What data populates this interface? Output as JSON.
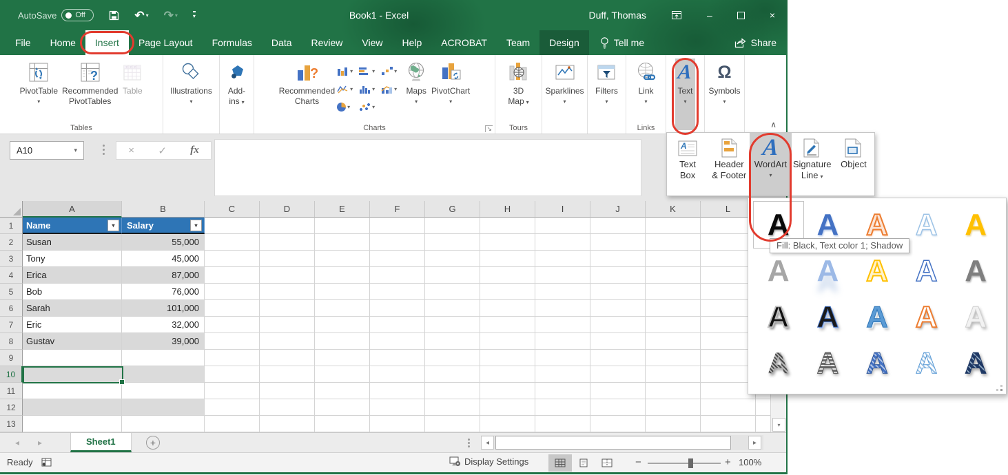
{
  "colors": {
    "title_green": "#217346",
    "design_tab_green": "#1A5C39",
    "table_header_blue": "#2E75B6",
    "band_gray": "#D9D9D9",
    "selection_green": "#217346",
    "annotation_red": "#E23B2E",
    "icon_blue": "#4472C4",
    "icon_gold": "#E8A33D"
  },
  "icons": {
    "dd": "▾",
    "undo": "↶",
    "redo": "↷",
    "minimize": "–",
    "close": "×",
    "collapse": "∧",
    "left": "◂",
    "right": "▸",
    "up": "▴",
    "down": "▾",
    "plus": "+",
    "minus": "−",
    "check": "✓",
    "cancel": "×",
    "omega": "Ω",
    "text_a": "A",
    "launcher": "↘"
  },
  "titlebar": {
    "autosave_label": "AutoSave",
    "autosave_state": "Off",
    "title": "Book1 - Excel",
    "user": "Duff, Thomas"
  },
  "tabs": {
    "items": [
      "File",
      "Home",
      "Insert",
      "Page Layout",
      "Formulas",
      "Data",
      "Review",
      "View",
      "Help",
      "ACROBAT",
      "Team",
      "Design"
    ],
    "active": "Insert",
    "tell_me": "Tell me",
    "share": "Share"
  },
  "ribbon": {
    "groups": {
      "tables": "Tables",
      "charts": "Charts",
      "tours": "Tours",
      "links": "Links"
    },
    "pivottable": "PivotTable",
    "recommended_pivottables_1": "Recommended",
    "recommended_pivottables_2": "PivotTables",
    "table": "Table",
    "illustrations": "Illustrations",
    "addins_1": "Add-",
    "addins_2": "ins",
    "recommended_charts_1": "Recommended",
    "recommended_charts_2": "Charts",
    "maps": "Maps",
    "pivotchart": "PivotChart",
    "map3d_1": "3D",
    "map3d_2": "Map",
    "sparklines": "Sparklines",
    "filters": "Filters",
    "link": "Link",
    "text": "Text",
    "symbols": "Symbols"
  },
  "formula_bar": {
    "name_box": "A10",
    "fx_label": "fx"
  },
  "text_menu": {
    "text_box_1": "Text",
    "text_box_2": "Box",
    "header_footer_1": "Header",
    "header_footer_2": "& Footer",
    "wordart": "WordArt",
    "signature_1": "Signature",
    "signature_2": "Line",
    "object": "Object"
  },
  "wordart": {
    "letter": "A",
    "tooltip": "Fill: Black, Text color 1; Shadow"
  },
  "sheet": {
    "columns": [
      "A",
      "B",
      "C",
      "D",
      "E",
      "F",
      "G",
      "H",
      "I",
      "J",
      "K",
      "L"
    ],
    "row_numbers": [
      "1",
      "2",
      "3",
      "4",
      "5",
      "6",
      "7",
      "8",
      "9",
      "10",
      "11",
      "12",
      "13"
    ],
    "table": {
      "headers": [
        "Name",
        "Salary"
      ],
      "data": [
        [
          "Susan",
          "55,000"
        ],
        [
          "Tony",
          "45,000"
        ],
        [
          "Erica",
          "87,000"
        ],
        [
          "Bob",
          "76,000"
        ],
        [
          "Sarah",
          "101,000"
        ],
        [
          "Eric",
          "32,000"
        ],
        [
          "Gustav",
          "39,000"
        ]
      ]
    },
    "active_cell": "A10",
    "sheet_tab": "Sheet1"
  },
  "statusbar": {
    "ready": "Ready",
    "display_settings": "Display Settings",
    "zoom": "100%"
  }
}
